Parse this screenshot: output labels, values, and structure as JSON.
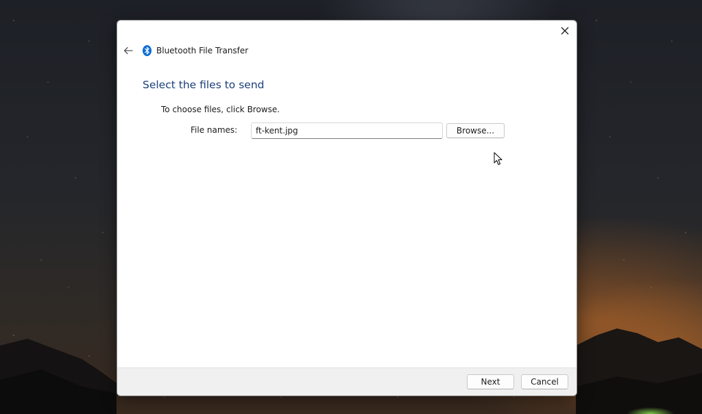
{
  "window": {
    "app_title": "Bluetooth File Transfer",
    "close_icon": "close-icon",
    "back_icon": "back-arrow-icon",
    "app_icon": "bluetooth-icon",
    "accent_color": "#1b3f7a",
    "bluetooth_color": "#0a6cd6"
  },
  "main": {
    "heading": "Select the files to send",
    "instruction": "To choose files, click Browse.",
    "file_names_label": "File names:",
    "file_names_value": "ft-kent.jpg",
    "browse_label": "Browse..."
  },
  "footer": {
    "next_label": "Next",
    "cancel_label": "Cancel"
  }
}
